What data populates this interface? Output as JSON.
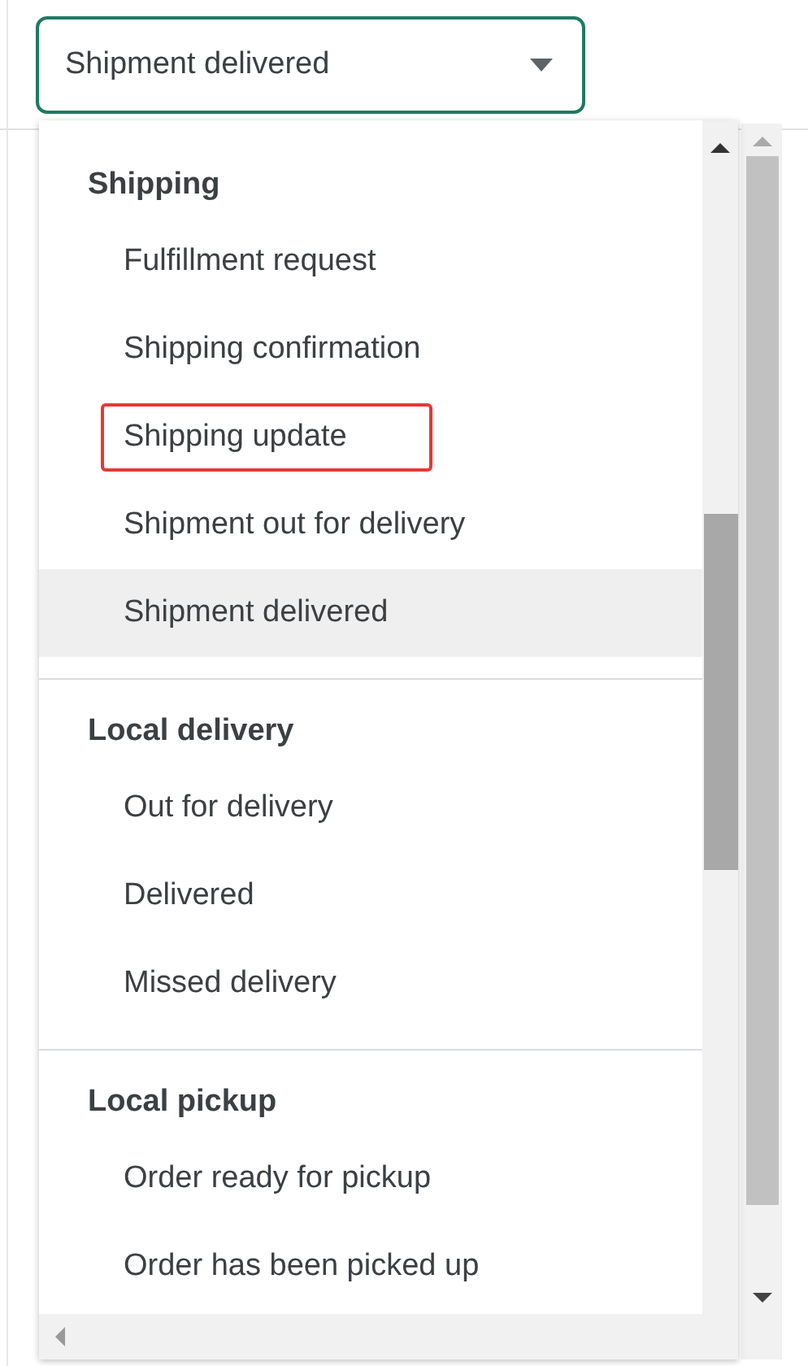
{
  "select": {
    "value": "Shipment delivered"
  },
  "menu": {
    "groups": [
      {
        "heading": "Shipping",
        "items": [
          {
            "label": "Fulfillment request",
            "selected": false,
            "highlighted": false
          },
          {
            "label": "Shipping confirmation",
            "selected": false,
            "highlighted": false
          },
          {
            "label": "Shipping update",
            "selected": false,
            "highlighted": true
          },
          {
            "label": "Shipment out for delivery",
            "selected": false,
            "highlighted": false
          },
          {
            "label": "Shipment delivered",
            "selected": true,
            "highlighted": false
          }
        ]
      },
      {
        "heading": "Local delivery",
        "items": [
          {
            "label": "Out for delivery",
            "selected": false,
            "highlighted": false
          },
          {
            "label": "Delivered",
            "selected": false,
            "highlighted": false
          },
          {
            "label": "Missed delivery",
            "selected": false,
            "highlighted": false
          }
        ]
      },
      {
        "heading": "Local pickup",
        "items": [
          {
            "label": "Order ready for pickup",
            "selected": false,
            "highlighted": false
          },
          {
            "label": "Order has been picked up",
            "selected": false,
            "highlighted": false
          }
        ]
      }
    ]
  }
}
